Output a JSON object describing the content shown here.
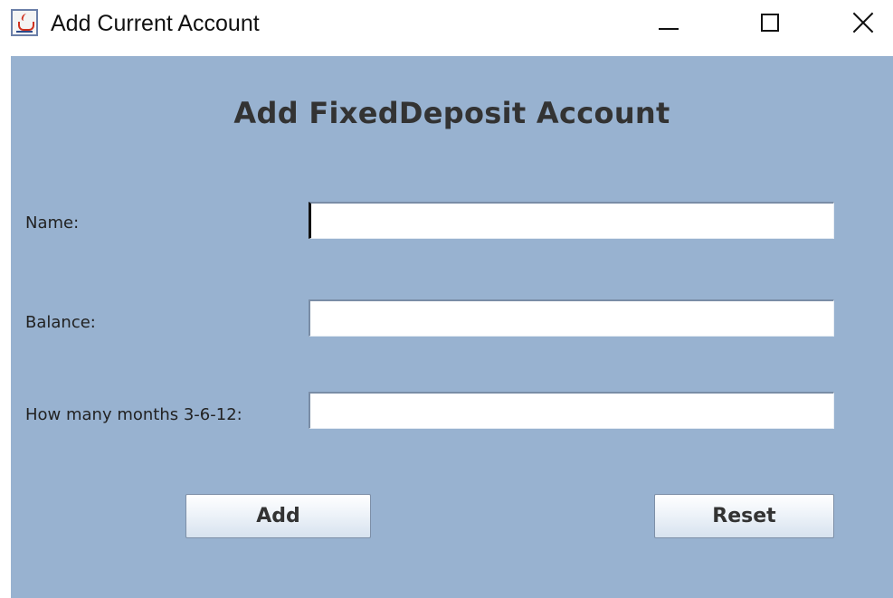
{
  "window": {
    "title": "Add Current Account",
    "controls": {
      "minimize_icon": "minimize-icon",
      "maximize_icon": "maximize-icon",
      "close_icon": "close-icon"
    },
    "app_icon": "java-cup-icon"
  },
  "form": {
    "heading": "Add FixedDeposit Account",
    "background_color": "#98b2d0",
    "fields": [
      {
        "label": "Name:",
        "value": "",
        "placeholder": ""
      },
      {
        "label": "Balance:",
        "value": "",
        "placeholder": ""
      },
      {
        "label": "How many months 3-6-12:",
        "value": "",
        "placeholder": ""
      }
    ],
    "buttons": {
      "add_label": "Add",
      "reset_label": "Reset"
    }
  }
}
